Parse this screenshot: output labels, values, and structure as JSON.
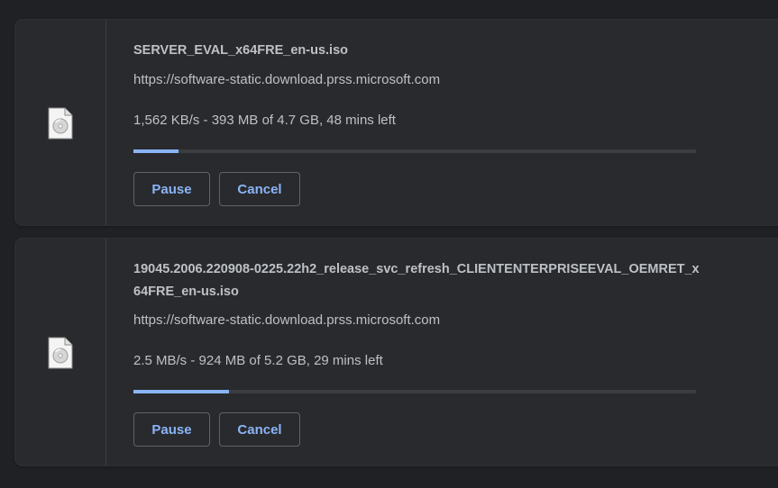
{
  "downloads": [
    {
      "filename": "SERVER_EVAL_x64FRE_en-us.iso",
      "url": "https://software-static.download.prss.microsoft.com",
      "status": "1,562 KB/s - 393 MB of 4.7 GB, 48 mins left",
      "progress_percent": 8,
      "icon": "file-icon",
      "pause_label": "Pause",
      "cancel_label": "Cancel"
    },
    {
      "filename": "19045.2006.220908-0225.22h2_release_svc_refresh_CLIENTENTERPRISEEVAL_OEMRET_x64FRE_en-us.iso",
      "url": "https://software-static.download.prss.microsoft.com",
      "status": "2.5 MB/s - 924 MB of 5.2 GB, 29 mins left",
      "progress_percent": 17,
      "icon": "file-icon",
      "pause_label": "Pause",
      "cancel_label": "Cancel"
    }
  ],
  "colors": {
    "background": "#202124",
    "card": "#292a2d",
    "text": "#bdc1c6",
    "accent": "#8ab4f8",
    "track": "#3c3d40"
  }
}
